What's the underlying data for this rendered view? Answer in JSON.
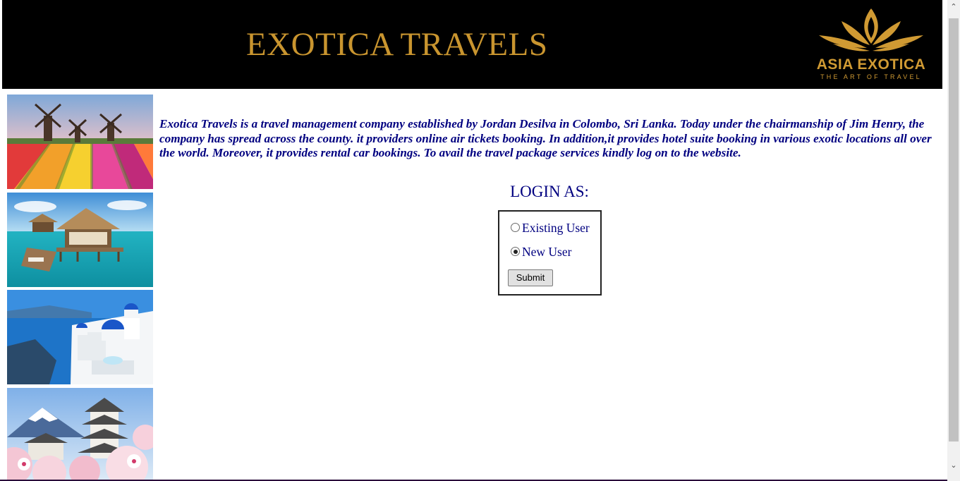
{
  "header": {
    "title": "EXOTICA TRAVELS",
    "logo_text": "ASIA EXOTICA",
    "logo_tagline": "THE ART OF TRAVEL",
    "background_color": "#000000",
    "title_color": "#c9952f"
  },
  "sidebar": {
    "images": [
      {
        "name": "tulip-windmill-photo"
      },
      {
        "name": "overwater-bungalow-photo"
      },
      {
        "name": "santorini-photo"
      },
      {
        "name": "japan-castle-fuji-photo"
      }
    ]
  },
  "intro": {
    "text": "Exotica Travels is a travel management company established by Jordan Desilva in Colombo, Sri Lanka. Today under the chairmanship of Jim Henry, the company has spread across the county. it providers online air tickets booking. In addition,it provides hotel suite booking in various exotic locations all over the world. Moreover, it provides rental car bookings. To avail the travel package services kindly log on to the website.",
    "color": "#000080"
  },
  "login": {
    "heading": "LOGIN AS:",
    "options": [
      {
        "label": "Existing User",
        "selected": false
      },
      {
        "label": "New User",
        "selected": true
      }
    ],
    "submit_label": "Submit"
  },
  "scrollbar": {
    "up_icon": "chevron-up-icon",
    "down_icon": "chevron-down-icon"
  }
}
